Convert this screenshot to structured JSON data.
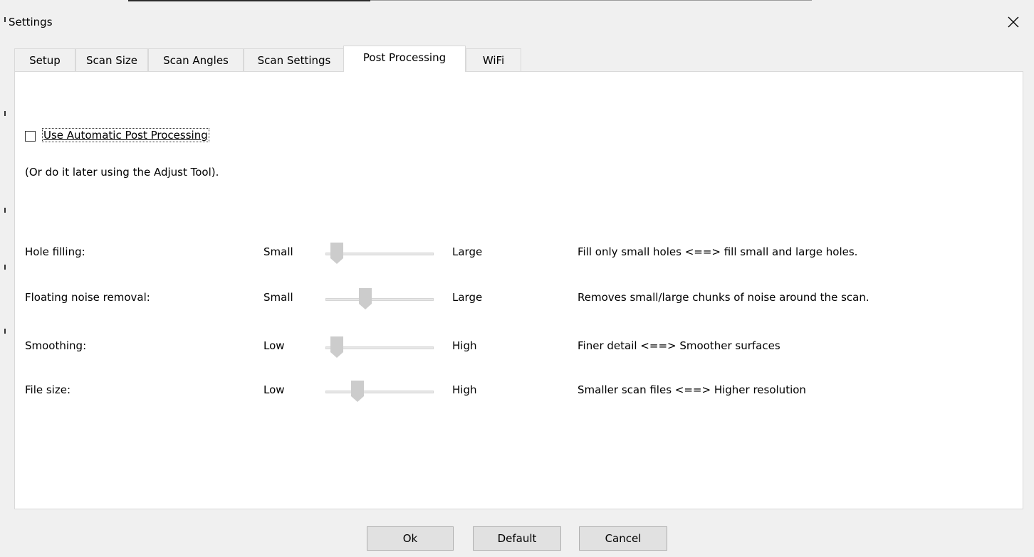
{
  "window": {
    "title": "Settings"
  },
  "tabs": [
    {
      "label": "Setup",
      "active": false
    },
    {
      "label": "Scan Size",
      "active": false
    },
    {
      "label": "Scan Angles",
      "active": false
    },
    {
      "label": "Scan Settings",
      "active": false
    },
    {
      "label": "Post Processing",
      "active": true
    },
    {
      "label": "WiFi",
      "active": false
    }
  ],
  "post_processing": {
    "auto": {
      "label": "Use Automatic Post Processing",
      "checked": false
    },
    "hint": "(Or do it later using the Adjust Tool).",
    "rows": [
      {
        "label": "Hole filling:",
        "min": "Small",
        "max": "Large",
        "value": 0.05,
        "description": "Fill only small holes <==> fill small and large holes."
      },
      {
        "label": "Floating noise removal:",
        "min": "Small",
        "max": "Large",
        "value": 0.35,
        "description": "Removes small/large chunks of noise around the scan."
      },
      {
        "label": "Smoothing:",
        "min": "Low",
        "max": "High",
        "value": 0.05,
        "description": "Finer detail  <==> Smoother surfaces"
      },
      {
        "label": "File size:",
        "min": "Low",
        "max": "High",
        "value": 0.27,
        "description": "Smaller scan files <==> Higher resolution"
      }
    ]
  },
  "buttons": {
    "ok": "Ok",
    "default": "Default",
    "cancel": "Cancel"
  },
  "colors": {
    "panel": "#ffffff",
    "window": "#f0f0f0",
    "slider_thumb": "#cccccc",
    "slider_track": "#e7e7e7"
  },
  "icons": {
    "close": "close-icon",
    "thumb": "slider-thumb"
  }
}
